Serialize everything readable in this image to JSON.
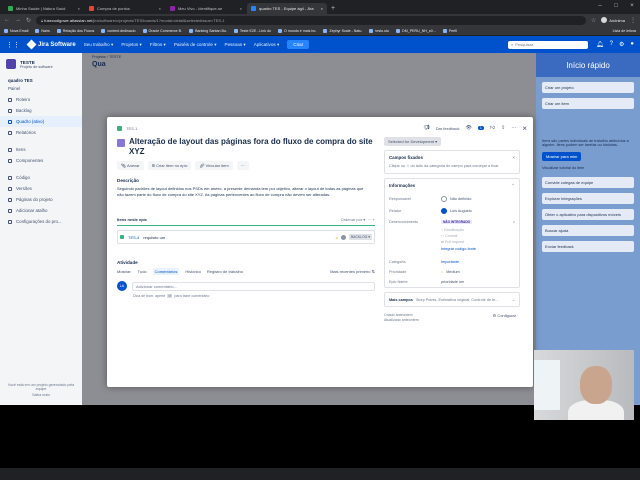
{
  "browser": {
    "tabs": [
      {
        "label": "Minha Saúde | Nátura Saúd",
        "color": "#34a853"
      },
      {
        "label": "Compra de pontos",
        "color": "#ea4335"
      },
      {
        "label": "Meu Vivo - Identifique-se",
        "color": "#8e24aa"
      },
      {
        "label": "quadro TES - Equipe ágil - Jira",
        "color": "#2684ff"
      }
    ],
    "url_prefix": "fusecodigowe.atlassian.net",
    "url_path": "/jira/software/c/projects/TES/boards/1?modal=detail&selectedIssue=TES-1",
    "profile_name": "Anônima",
    "bookmarks": [
      "Nova Email",
      "Nairs",
      "Relação dos Fluxos",
      "content.dedinacio",
      "Oracle Commerce B.",
      "Banking Santan Bu.",
      "Teste E2E - Link do",
      "O mundo é mais bo.",
      "Zephyr Scale - Natu.",
      "testo.utu",
      "DM_PERU_NH_s0...",
      "Perfil"
    ],
    "bookmarks_right": "Lista de leitura"
  },
  "jira_nav": {
    "logo": "Jira Software",
    "items": [
      "Seu trabalho ▾",
      "Projetos ▾",
      "Filtros ▾",
      "Painéis de controle ▾",
      "Pessoas ▾",
      "Aplicativos ▾"
    ],
    "create": "Criar",
    "search_placeholder": "Pesquisar"
  },
  "sidebar": {
    "project_name": "TESTE",
    "project_type": "Projeto de software",
    "board_name": "quadro TES",
    "board_sub": "Painel",
    "items": [
      "Roteiro",
      "Backlog",
      "Quadro (ativo)",
      "Relatórios",
      "Itens",
      "Componentes",
      "Código",
      "Versões",
      "Páginas do projeto",
      "Adicionar atalho",
      "Configurações do pro..."
    ],
    "footer": "Você está em um projeto gerenciado pela equipe",
    "footer_link": "Saiba mais"
  },
  "board": {
    "crumb": "Projetos / TESTE",
    "title": "Qua"
  },
  "right_panel": {
    "title": "Início rápido",
    "items": [
      "Criar um projeto",
      "Criar um item"
    ],
    "text": "Itens são partes individuais de trabalho atribuídos a alguém. Itens podem ser tarefas ou histórias.",
    "button": "Mostrar para mim",
    "link": "Visualizar tutorial do item",
    "more": [
      "Convide colegas de equipe",
      "Explorar Integrações",
      "Obter o aplicativo para dispositivos móveis",
      "Buscar ajuda",
      "Enviar feedback"
    ]
  },
  "issue": {
    "key": "TES-1",
    "feedback": "Dar feedback",
    "watchers": "1",
    "title": "Alteração de layout das páginas fora do fluxo de compra do site XYZ",
    "actions": [
      "Anexar",
      "Criar item no epic",
      "Vincular item",
      "···"
    ],
    "description_label": "Descrição",
    "description": "Seguindo padrões de layout definidos nos PSDs em anexo, a presente demanda tem por objetivo, alterar o layout de todas as páginas que não fazem parte do fluxo de compra do site XYZ. As páginas pertencentes ao fluxo de compra não devem ser alteradas.",
    "children_label": "Itens neste epic",
    "children_sort": "Ordenar por ▾",
    "children_add": "+",
    "child": {
      "key": "TES-4",
      "summary": "requisito um",
      "status": "BACKLOG ▾"
    },
    "activity_label": "Atividade",
    "activity_show": "Mostrar:",
    "activity_tabs": [
      "Tudo",
      "Comentários",
      "Histórico",
      "Registro de trabalho"
    ],
    "activity_sort": "Mais recentes primeiro ⇅",
    "avatar_initials": "LA",
    "comment_placeholder": "Adicionar comentário...",
    "tip": "Dica de bom: aperte",
    "tip_key": "M",
    "tip_end": "para fazer comentário"
  },
  "details": {
    "status_button": "Selected for Development ▾",
    "pinned_title": "Campos fixados",
    "pinned_text": "Clique no ☆ do lado da categoria do campo para começar a fixar.",
    "info_title": "Informações",
    "assignee_label": "Responsável",
    "assignee": "Não definido",
    "reporter_label": "Relator",
    "reporter": "Luis Augusto",
    "dev_label": "Desenvolvimento",
    "dev_status": "NÃO INTEGRADO",
    "dev_items": [
      "Ramificação",
      "Commit",
      "Pull request"
    ],
    "dev_link": "Integrar código-fonte",
    "category_label": "Categoria",
    "category": "Importante",
    "priority_label": "Prioridade",
    "priority": "Medium",
    "epic_label": "Epic Name",
    "epic": "prioridade um",
    "more_label": "Mais campos",
    "more_text": "Story Points, Estimativa original, Controle de te...",
    "created": "Criado anteontem",
    "updated": "Atualizado anteontem",
    "configure": "Configurar"
  },
  "colors": {
    "jira_blue": "#0052cc",
    "epic_purple": "#8777d9",
    "story_green": "#36b37e"
  }
}
